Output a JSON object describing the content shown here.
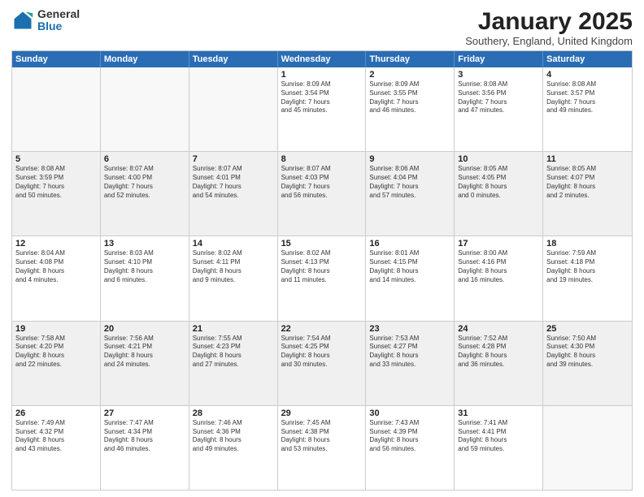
{
  "logo": {
    "general": "General",
    "blue": "Blue"
  },
  "title": "January 2025",
  "location": "Southery, England, United Kingdom",
  "days": [
    "Sunday",
    "Monday",
    "Tuesday",
    "Wednesday",
    "Thursday",
    "Friday",
    "Saturday"
  ],
  "rows": [
    [
      {
        "day": "",
        "text": "",
        "empty": true
      },
      {
        "day": "",
        "text": "",
        "empty": true
      },
      {
        "day": "",
        "text": "",
        "empty": true
      },
      {
        "day": "1",
        "text": "Sunrise: 8:09 AM\nSunset: 3:54 PM\nDaylight: 7 hours\nand 45 minutes."
      },
      {
        "day": "2",
        "text": "Sunrise: 8:09 AM\nSunset: 3:55 PM\nDaylight: 7 hours\nand 46 minutes."
      },
      {
        "day": "3",
        "text": "Sunrise: 8:08 AM\nSunset: 3:56 PM\nDaylight: 7 hours\nand 47 minutes."
      },
      {
        "day": "4",
        "text": "Sunrise: 8:08 AM\nSunset: 3:57 PM\nDaylight: 7 hours\nand 49 minutes."
      }
    ],
    [
      {
        "day": "5",
        "text": "Sunrise: 8:08 AM\nSunset: 3:59 PM\nDaylight: 7 hours\nand 50 minutes.",
        "shaded": true
      },
      {
        "day": "6",
        "text": "Sunrise: 8:07 AM\nSunset: 4:00 PM\nDaylight: 7 hours\nand 52 minutes.",
        "shaded": true
      },
      {
        "day": "7",
        "text": "Sunrise: 8:07 AM\nSunset: 4:01 PM\nDaylight: 7 hours\nand 54 minutes.",
        "shaded": true
      },
      {
        "day": "8",
        "text": "Sunrise: 8:07 AM\nSunset: 4:03 PM\nDaylight: 7 hours\nand 56 minutes.",
        "shaded": true
      },
      {
        "day": "9",
        "text": "Sunrise: 8:06 AM\nSunset: 4:04 PM\nDaylight: 7 hours\nand 57 minutes.",
        "shaded": true
      },
      {
        "day": "10",
        "text": "Sunrise: 8:05 AM\nSunset: 4:05 PM\nDaylight: 8 hours\nand 0 minutes.",
        "shaded": true
      },
      {
        "day": "11",
        "text": "Sunrise: 8:05 AM\nSunset: 4:07 PM\nDaylight: 8 hours\nand 2 minutes.",
        "shaded": true
      }
    ],
    [
      {
        "day": "12",
        "text": "Sunrise: 8:04 AM\nSunset: 4:08 PM\nDaylight: 8 hours\nand 4 minutes."
      },
      {
        "day": "13",
        "text": "Sunrise: 8:03 AM\nSunset: 4:10 PM\nDaylight: 8 hours\nand 6 minutes."
      },
      {
        "day": "14",
        "text": "Sunrise: 8:02 AM\nSunset: 4:11 PM\nDaylight: 8 hours\nand 9 minutes."
      },
      {
        "day": "15",
        "text": "Sunrise: 8:02 AM\nSunset: 4:13 PM\nDaylight: 8 hours\nand 11 minutes."
      },
      {
        "day": "16",
        "text": "Sunrise: 8:01 AM\nSunset: 4:15 PM\nDaylight: 8 hours\nand 14 minutes."
      },
      {
        "day": "17",
        "text": "Sunrise: 8:00 AM\nSunset: 4:16 PM\nDaylight: 8 hours\nand 16 minutes."
      },
      {
        "day": "18",
        "text": "Sunrise: 7:59 AM\nSunset: 4:18 PM\nDaylight: 8 hours\nand 19 minutes."
      }
    ],
    [
      {
        "day": "19",
        "text": "Sunrise: 7:58 AM\nSunset: 4:20 PM\nDaylight: 8 hours\nand 22 minutes.",
        "shaded": true
      },
      {
        "day": "20",
        "text": "Sunrise: 7:56 AM\nSunset: 4:21 PM\nDaylight: 8 hours\nand 24 minutes.",
        "shaded": true
      },
      {
        "day": "21",
        "text": "Sunrise: 7:55 AM\nSunset: 4:23 PM\nDaylight: 8 hours\nand 27 minutes.",
        "shaded": true
      },
      {
        "day": "22",
        "text": "Sunrise: 7:54 AM\nSunset: 4:25 PM\nDaylight: 8 hours\nand 30 minutes.",
        "shaded": true
      },
      {
        "day": "23",
        "text": "Sunrise: 7:53 AM\nSunset: 4:27 PM\nDaylight: 8 hours\nand 33 minutes.",
        "shaded": true
      },
      {
        "day": "24",
        "text": "Sunrise: 7:52 AM\nSunset: 4:28 PM\nDaylight: 8 hours\nand 36 minutes.",
        "shaded": true
      },
      {
        "day": "25",
        "text": "Sunrise: 7:50 AM\nSunset: 4:30 PM\nDaylight: 8 hours\nand 39 minutes.",
        "shaded": true
      }
    ],
    [
      {
        "day": "26",
        "text": "Sunrise: 7:49 AM\nSunset: 4:32 PM\nDaylight: 8 hours\nand 43 minutes."
      },
      {
        "day": "27",
        "text": "Sunrise: 7:47 AM\nSunset: 4:34 PM\nDaylight: 8 hours\nand 46 minutes."
      },
      {
        "day": "28",
        "text": "Sunrise: 7:46 AM\nSunset: 4:36 PM\nDaylight: 8 hours\nand 49 minutes."
      },
      {
        "day": "29",
        "text": "Sunrise: 7:45 AM\nSunset: 4:38 PM\nDaylight: 8 hours\nand 53 minutes."
      },
      {
        "day": "30",
        "text": "Sunrise: 7:43 AM\nSunset: 4:39 PM\nDaylight: 8 hours\nand 56 minutes."
      },
      {
        "day": "31",
        "text": "Sunrise: 7:41 AM\nSunset: 4:41 PM\nDaylight: 8 hours\nand 59 minutes."
      },
      {
        "day": "",
        "text": "",
        "empty": true
      }
    ]
  ]
}
